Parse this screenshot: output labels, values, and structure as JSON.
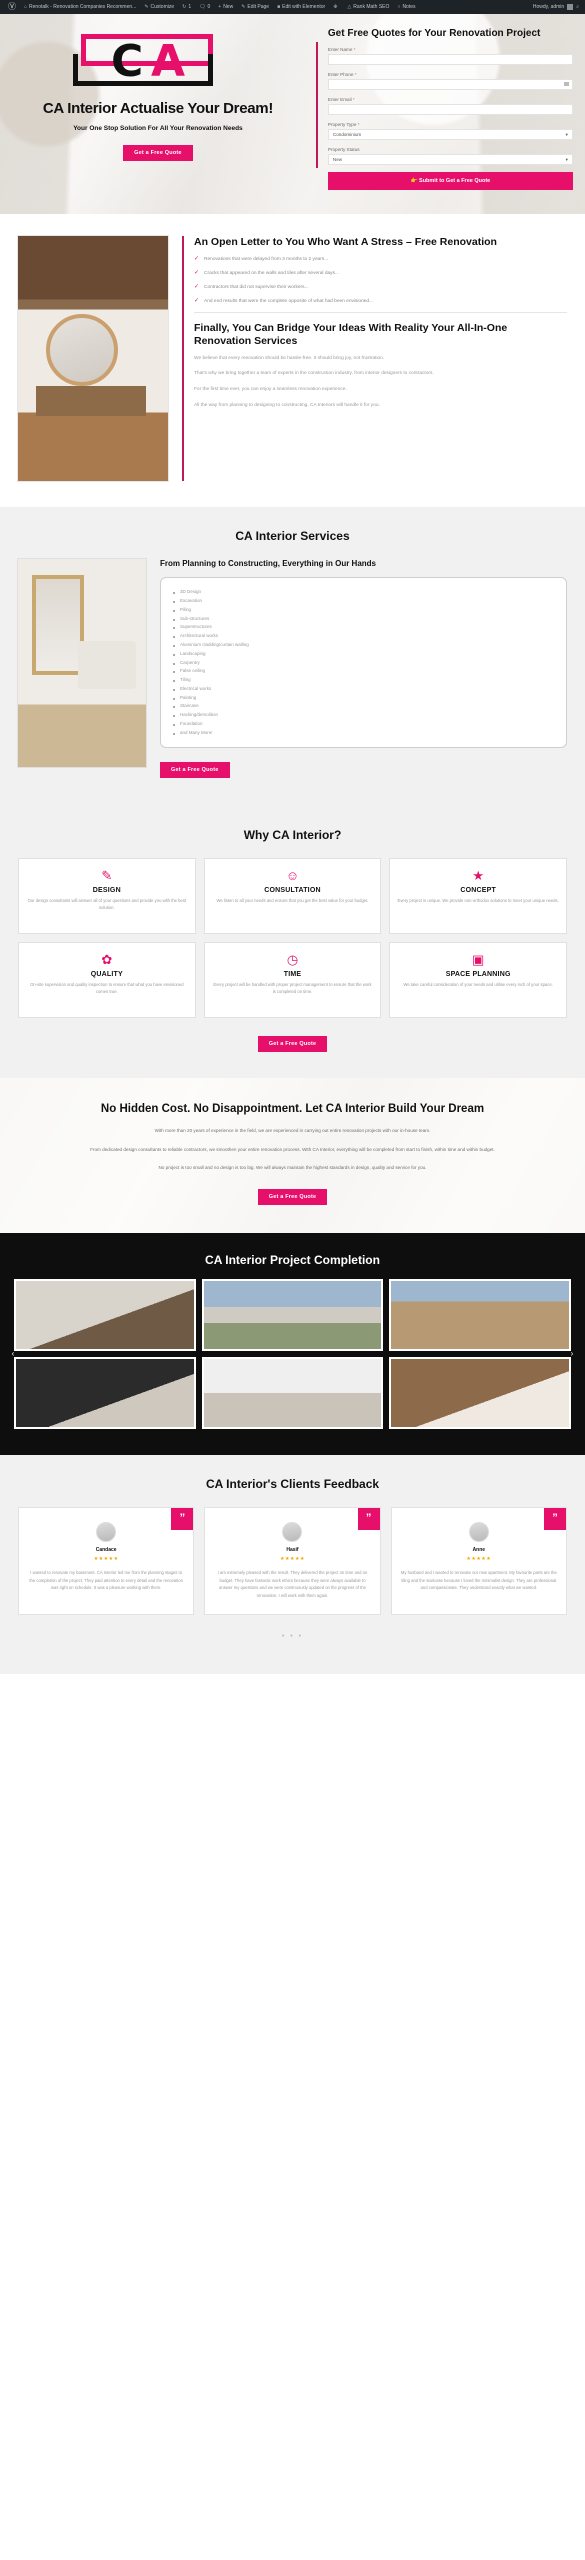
{
  "adminbar": {
    "logo_icon": "wordpress-icon",
    "items": [
      {
        "icon": "home-icon",
        "label": "Renotalk - Renovation Companies Recommen..."
      },
      {
        "icon": "brush-icon",
        "label": "Customize"
      },
      {
        "icon": "comment-bubble-icon",
        "label": "1"
      },
      {
        "icon": "speech-icon",
        "label": "0"
      },
      {
        "icon": "plus-icon",
        "label": "New"
      },
      {
        "icon": "pencil-icon",
        "label": "Edit Page"
      },
      {
        "icon": "elementor-icon",
        "label": "Edit with Elementor"
      },
      {
        "icon": "gear-icon",
        "label": ""
      },
      {
        "icon": "rank-math-icon",
        "label": "Rank Math SEO"
      },
      {
        "icon": "notes-icon",
        "label": "Notes"
      }
    ],
    "howdy": "Howdy, admin"
  },
  "hero": {
    "logo_alt": "CA Interior logo",
    "heading": "CA Interior Actualise Your Dream!",
    "subheading": "Your One Stop Solution For All Your Renovation Needs",
    "cta_label": "Get a Free Quote",
    "form": {
      "title": "Get Free Quotes for Your Renovation Project",
      "fields": [
        {
          "label": "Enter Name",
          "required": "*",
          "value": "",
          "type": "text"
        },
        {
          "label": "Enter Phone",
          "required": "*",
          "value": "",
          "type": "tel"
        },
        {
          "label": "Enter Email",
          "required": "*",
          "value": "",
          "type": "email"
        }
      ],
      "property_type": {
        "label": "Property Type",
        "required": "*",
        "value": "Condominium"
      },
      "property_status": {
        "label": "Property Status",
        "required": "",
        "value": "New"
      },
      "submit_label": "Submit to Get a Free Quote",
      "submit_icon": "pointing-hand-icon"
    }
  },
  "letter": {
    "heading": "An Open Letter to You Who Want A Stress\n– Free Renovation",
    "checklist": [
      "Renovations that were delayed from 3 months to 2 years...",
      "Cracks that appeared on the walls and tiles after several days...",
      "Contractors that did not supervise their workers...",
      "And end results that were the complete opposite of what had been envisioned..."
    ],
    "heading2": "Finally, You Can Bridge Your Ideas With Reality Your All-In-One Renovation Services",
    "paragraphs": [
      "We believe that every renovation should be hassle-free. It should bring joy, not frustration.",
      "That's why we bring together a team of experts in the construction industry, from interior designers to contractors.",
      "For the first time ever, you can enjoy a seamless renovation experience.",
      "All the way from planning to designing to constructing, CA Interiors will handle it for you."
    ]
  },
  "services": {
    "section_title": "CA Interior Services",
    "heading": "From Planning to Constructing, Everything in Our Hands",
    "items": [
      "3D Design",
      "Excavation",
      "Piling",
      "Sub-structures",
      "Superstructures",
      "Architectural works",
      "Aluminium cladding/curtain walling",
      "Landscaping",
      "Carpentry",
      "False ceiling",
      "Tiling",
      "Electrical works",
      "Painting",
      "Staircase",
      "Hacking/demolition",
      "Foundation",
      "and Many More!"
    ],
    "cta_label": "Get a Free Quote"
  },
  "why": {
    "section_title": "Why CA Interior?",
    "cards": [
      {
        "icon": "design-pen-icon",
        "title": "DESIGN",
        "desc": "Our design consultants will answer all of your questions and provide you with the best solution."
      },
      {
        "icon": "consultation-person-icon",
        "title": "CONSULTATION",
        "desc": "We listen to all your needs and ensure that you get the best value for your budget."
      },
      {
        "icon": "concept-lightbulb-icon",
        "title": "CONCEPT",
        "desc": "Every project is unique. We provide non-orthodox solutions to meet your unique needs."
      },
      {
        "icon": "quality-badge-icon",
        "title": "QUALITY",
        "desc": "On-site supervision and quality inspection to ensure that what you have envisioned comes true."
      },
      {
        "icon": "time-clock-icon",
        "title": "TIME",
        "desc": "Every project will be handled with proper project management to ensure that the work is completed on time."
      },
      {
        "icon": "space-planning-icon",
        "title": "SPACE PLANNING",
        "desc": "We take careful consideration of your needs and utilise every inch of your space."
      }
    ],
    "cta_label": "Get a Free Quote"
  },
  "nohidden": {
    "heading": "No Hidden Cost. No Disappointment. Let CA Interior Build Your Dream",
    "paragraphs": [
      "With more than 20 years of experience in the field, we are experienced in carrying out entire renovation projects with our in-house team.",
      "From dedicated design consultants to reliable contractors, we smoothen your entire renovation process. With CA Interior, everything will be completed from start to finish, within time and within budget.",
      "No project is too small and no design is too big. We will always maintain the highest standards in design, quality and service for you."
    ],
    "cta_label": "Get a Free Quote"
  },
  "projects": {
    "section_title": "CA Interior Project Completion",
    "prev_icon": "chevron-left-icon",
    "next_icon": "chevron-right-icon",
    "tiles": [
      {
        "alt": "kitchen-interior-photo"
      },
      {
        "alt": "house-exterior-photo"
      },
      {
        "alt": "construction-site-photo"
      },
      {
        "alt": "dark-living-room-photo"
      },
      {
        "alt": "white-kitchen-photo"
      },
      {
        "alt": "wooden-staircase-photo"
      }
    ]
  },
  "testimonials": {
    "section_title": "CA Interior's Clients Feedback",
    "quote_icon": "quote-mark-icon",
    "cards": [
      {
        "avatar": "avatar-candace",
        "name": "Candace",
        "stars": "★★★★★",
        "text": "I wanted to renovate my basement. CA Interior led me from the planning stages to the completion of the project. They paid attention to every detail and the renovation was right on schedule. It was a pleasure working with them."
      },
      {
        "avatar": "avatar-hasif",
        "name": "Hasif",
        "stars": "★★★★★",
        "text": "I am extremely pleased with the result. They delivered the project on time and on budget. They have fantastic work ethics because they were always available to answer my questions and we were continuously updated on the progress of the renovation. I will work with them again."
      },
      {
        "avatar": "avatar-anne",
        "name": "Anne",
        "stars": "★★★★★",
        "text": "My husband and I wanted to renovate our new apartment. My favourite parts are the tiling and the staircase because I loved the minimalist design. They are professional and compassionate. They understood exactly what we wanted."
      }
    ],
    "pagination_dots": "• • •"
  },
  "colors": {
    "accent": "#e6106a",
    "accent_dark": "#c2185b",
    "dark_bg": "#0e0e0e",
    "light_bg": "#f1f1f1",
    "adminbar_bg": "#1d2327"
  }
}
